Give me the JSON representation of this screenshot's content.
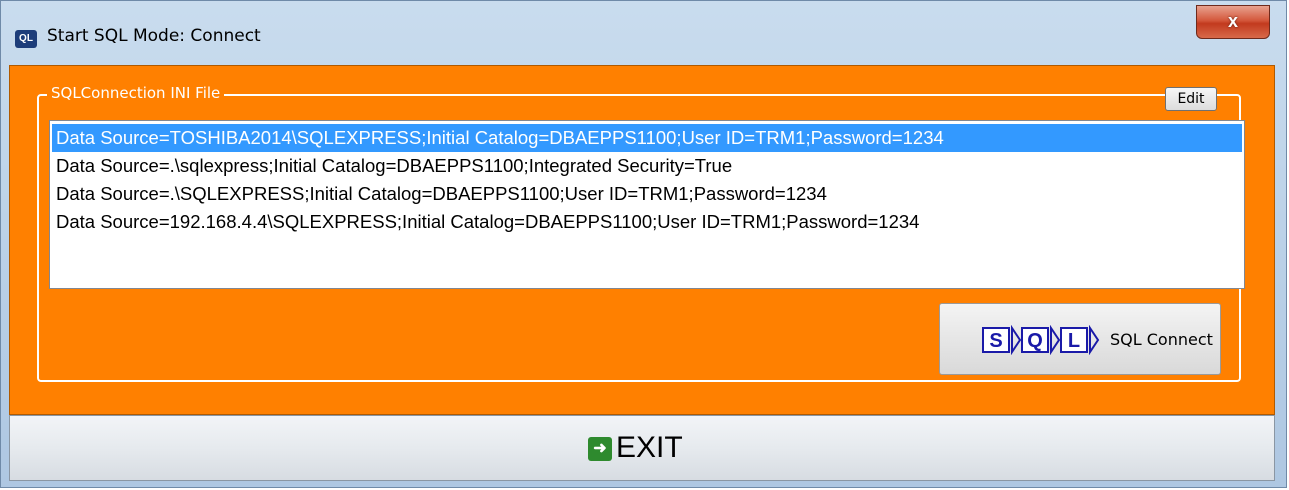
{
  "window": {
    "title": "Start SQL Mode: Connect",
    "close_label": "x"
  },
  "groupbox": {
    "label": "SQLConnection INI File",
    "edit_label": "Edit"
  },
  "connections": [
    {
      "text": "Data Source=TOSHIBA2014\\SQLEXPRESS;Initial Catalog=DBAEPPS1100;User ID=TRM1;Password=1234",
      "selected": true
    },
    {
      "text": "Data Source=.\\sqlexpress;Initial Catalog=DBAEPPS1100;Integrated Security=True",
      "selected": false
    },
    {
      "text": "Data Source=.\\SQLEXPRESS;Initial Catalog=DBAEPPS1100;User ID=TRM1;Password=1234",
      "selected": false
    },
    {
      "text": "Data Source=192.168.4.4\\SQLEXPRESS;Initial Catalog=DBAEPPS1100;User ID=TRM1;Password=1234",
      "selected": false
    }
  ],
  "connect_button": {
    "label": "SQL Connect",
    "logo_letters": [
      "S",
      "Q",
      "L"
    ]
  },
  "exit_button": {
    "label": "EXIT"
  },
  "colors": {
    "panel": "#ff8000",
    "selection": "#3399ff"
  }
}
